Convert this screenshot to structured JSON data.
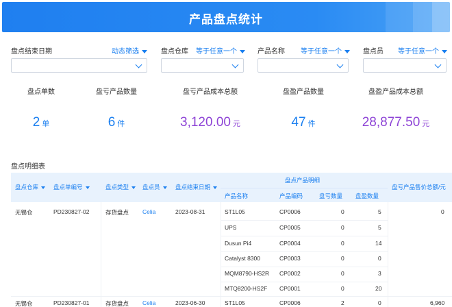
{
  "header": {
    "title": "产品盘点统计"
  },
  "filters": [
    {
      "label": "盘点结束日期",
      "mode": "动态筛选",
      "value": ""
    },
    {
      "label": "盘点仓库",
      "mode": "等于任意一个",
      "value": ""
    },
    {
      "label": "产品名称",
      "mode": "等于任意一个",
      "value": ""
    },
    {
      "label": "盘点员",
      "mode": "等于任意一个",
      "value": ""
    }
  ],
  "kpis": [
    {
      "label": "盘点单数",
      "value": "2",
      "unit": "单",
      "color": "#1a7ff0"
    },
    {
      "label": "盘亏产品数量",
      "value": "6",
      "unit": "件",
      "color": "#1a7ff0"
    },
    {
      "label": "盘亏产品成本总额",
      "value": "3,120.00",
      "unit": "元",
      "color": "#8e44d6"
    },
    {
      "label": "盘盈产品数量",
      "value": "47",
      "unit": "件",
      "color": "#1a7ff0"
    },
    {
      "label": "盘盈产品成本总额",
      "value": "28,877.50",
      "unit": "元",
      "color": "#8e44d6"
    }
  ],
  "detail": {
    "title": "盘点明细表",
    "headers": {
      "warehouse": "盘点仓库",
      "order_no": "盘点单编号",
      "type": "盘点类型",
      "clerk": "盘点员",
      "end_date": "盘点结束日期",
      "group": "盘点产品明细",
      "product_name": "产品名称",
      "product_code": "产品编码",
      "loss_qty": "盘亏数量",
      "gain_qty": "盘盈数量",
      "loss_amount": "盘亏产品售价总额/元"
    },
    "orders": [
      {
        "warehouse": "无锡仓",
        "order_no": "PD230827-02",
        "type": "存货盘点",
        "clerk": "Celia",
        "end_date": "2023-08-31",
        "loss_amount": "0",
        "items": [
          {
            "name": "ST1L05",
            "code": "CP0006",
            "loss": "0",
            "gain": "5"
          },
          {
            "name": "UPS",
            "code": "CP0005",
            "loss": "0",
            "gain": "5"
          },
          {
            "name": "Dusun Pi4",
            "code": "CP0004",
            "loss": "0",
            "gain": "14"
          },
          {
            "name": "Catalyst 8300",
            "code": "CP0003",
            "loss": "0",
            "gain": "0"
          },
          {
            "name": "MQM8790-HS2R",
            "code": "CP0002",
            "loss": "0",
            "gain": "3"
          },
          {
            "name": "MTQ8200-HS2F",
            "code": "CP0001",
            "loss": "0",
            "gain": "20"
          }
        ]
      },
      {
        "warehouse": "无锡仓",
        "order_no": "PD230827-01",
        "type": "存货盘点",
        "clerk": "Celia",
        "end_date": "2023-06-30",
        "loss_amount": "6,960",
        "items": [
          {
            "name": "ST1L05",
            "code": "CP0006",
            "loss": "2",
            "gain": "0"
          }
        ]
      }
    ]
  }
}
